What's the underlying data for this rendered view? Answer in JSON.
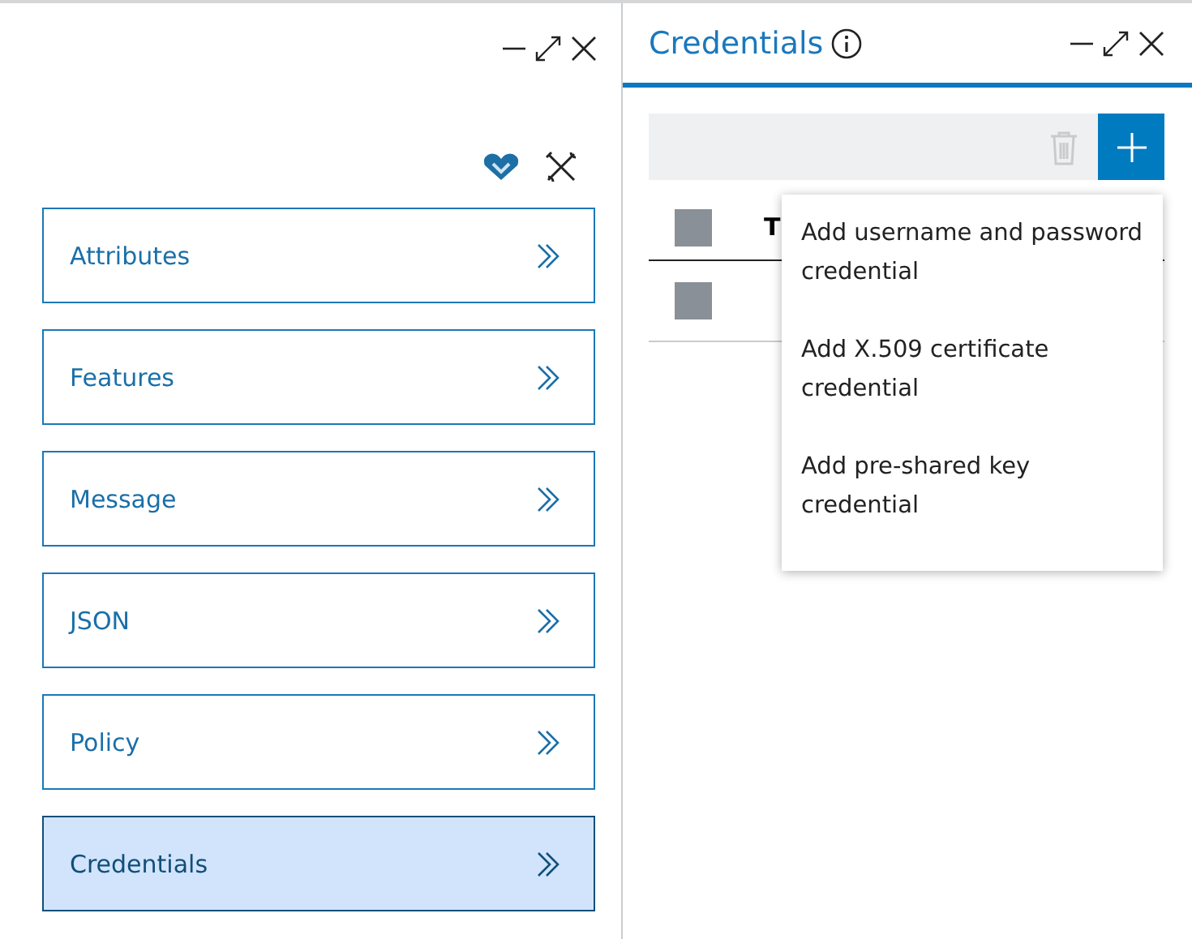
{
  "left_panel": {
    "nav_items": [
      {
        "label": "Attributes",
        "selected": false
      },
      {
        "label": "Features",
        "selected": false
      },
      {
        "label": "Message",
        "selected": false
      },
      {
        "label": "JSON",
        "selected": false
      },
      {
        "label": "Policy",
        "selected": false
      },
      {
        "label": "Credentials",
        "selected": true
      }
    ]
  },
  "right_panel": {
    "title": "Credentials",
    "table": {
      "header_checked": false,
      "columns": [
        "T"
      ],
      "rows": [
        {
          "checked": false
        }
      ]
    },
    "add_menu": {
      "items": [
        "Add username and password credential",
        "Add X.509 certificate credential",
        "Add pre-shared key credential"
      ]
    }
  }
}
